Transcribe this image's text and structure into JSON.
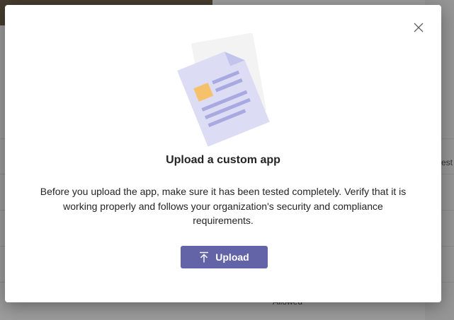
{
  "dialog": {
    "title": "Upload a custom app",
    "body": "Before you upload the app, make sure it has been tested completely. Verify that it is working properly and follows your organization's security and compliance requirements.",
    "upload_label": "Upload",
    "close_icon": "close-icon",
    "upload_icon": "upload-arrow-icon",
    "illustration": "document-illustration"
  },
  "background": {
    "row_fragment_right": "est",
    "row_fragment_bottom": "Allowed"
  },
  "colors": {
    "accent": "#6264a7",
    "overlay": "#6d6d6d",
    "illustration_page": "#dcdcf5",
    "illustration_lines": "#a7a9e0",
    "illustration_block": "#f5c26b"
  }
}
